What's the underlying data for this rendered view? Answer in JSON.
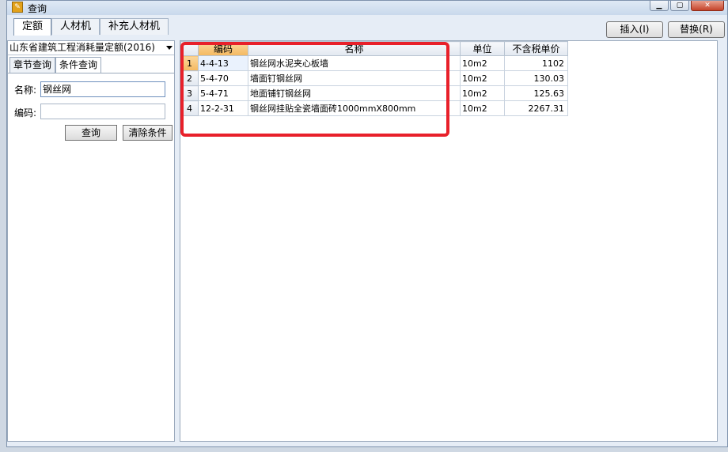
{
  "window": {
    "title": "查询"
  },
  "top_tabs": [
    {
      "label": "定额"
    },
    {
      "label": "人材机"
    },
    {
      "label": "补充人材机"
    }
  ],
  "actions": {
    "insert_label": "插入(I)",
    "replace_label": "替换(R)"
  },
  "left": {
    "database": "山东省建筑工程消耗量定额(2016)",
    "subtabs": [
      {
        "label": "章节查询"
      },
      {
        "label": "条件查询"
      }
    ],
    "name_label": "名称:",
    "name_value": "钢丝网",
    "code_label": "编码:",
    "code_value": "",
    "query_button": "查询",
    "clear_button": "清除条件"
  },
  "table": {
    "columns": [
      "",
      "编码",
      "名称",
      "单位",
      "不含税单价"
    ],
    "rows": [
      {
        "n": "1",
        "code": "4-4-13",
        "name": "钢丝网水泥夹心板墙",
        "unit": "10m2",
        "price": "1102"
      },
      {
        "n": "2",
        "code": "5-4-70",
        "name": "墙面钉钢丝网",
        "unit": "10m2",
        "price": "130.03"
      },
      {
        "n": "3",
        "code": "5-4-71",
        "name": "地面铺钉钢丝网",
        "unit": "10m2",
        "price": "125.63"
      },
      {
        "n": "4",
        "code": "12-2-31",
        "name": "钢丝网挂贴全瓷墙面砖1000mmX800mm",
        "unit": "10m2",
        "price": "2267.31"
      }
    ]
  },
  "colors": {
    "highlight_box": "#e8202a",
    "selected_header": "#f4b860"
  }
}
